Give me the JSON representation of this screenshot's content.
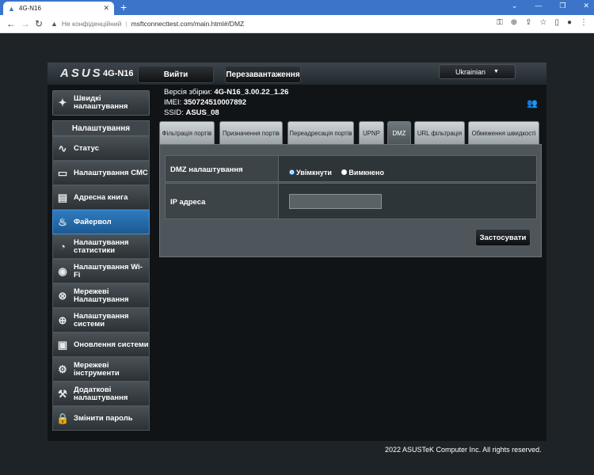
{
  "browser": {
    "tab_title": "4G-N16",
    "tab_close": "✕",
    "new_tab": "+",
    "address_warning": "Не конфіденційний",
    "address_url": "msftconnecttest.com/main.html#/DMZ"
  },
  "header": {
    "logo": "ASUS",
    "model": "4G-N16",
    "buttons": {
      "logout": "Вийти",
      "reboot": "Перезавантаження"
    },
    "language": "Ukrainian"
  },
  "info": {
    "firmware_label": "Версія збірки:",
    "firmware_value": "4G-N16_3.00.22_1.26",
    "imei_label": "IMEI:",
    "imei_value": "350724510007892",
    "ssid_label": "SSID:",
    "ssid_value": "ASUS_08"
  },
  "sidebar": {
    "quick_setup": "Швидкі налаштування",
    "settings_header": "Налаштування",
    "items": [
      {
        "label": "Статус",
        "icon": "pulse-icon"
      },
      {
        "label": "Налаштування СМС",
        "icon": "sms-icon"
      },
      {
        "label": "Адресна книга",
        "icon": "address-book-icon"
      },
      {
        "label": "Файервол",
        "icon": "fire-icon"
      },
      {
        "label": "Налаштування статистики",
        "icon": "statistics-icon"
      },
      {
        "label": "Налаштування Wi-Fi",
        "icon": "wifi-icon"
      },
      {
        "label": "Мережеві Налаштування",
        "icon": "network-icon"
      },
      {
        "label": "Налаштування системи",
        "icon": "globe-icon"
      },
      {
        "label": "Оновлення системи",
        "icon": "monitor-icon"
      },
      {
        "label": "Мережеві інструменти",
        "icon": "tools-icon"
      },
      {
        "label": "Додаткові налаштування",
        "icon": "gear-icon"
      },
      {
        "label": "Змінити пароль",
        "icon": "lock-icon"
      }
    ],
    "active_index": 3
  },
  "tabs": [
    {
      "label": "Фільтрація портів"
    },
    {
      "label": "Призначення портів"
    },
    {
      "label": "Переадресація портів"
    },
    {
      "label": "UPNP"
    },
    {
      "label": "DMZ"
    },
    {
      "label": "URL фільтрація"
    },
    {
      "label": "Обмеження швидкості"
    }
  ],
  "active_tab": "DMZ",
  "form": {
    "dmz_label": "DMZ налаштування",
    "option_on": "Увімкнути",
    "option_off": "Вимкнено",
    "selected": "Увімкнути",
    "ip_label": "IP адреса",
    "ip_value": "",
    "apply": "Застосувати"
  },
  "footer": {
    "copyright": "2022 ASUSTeK Computer Inc. All rights reserved."
  }
}
